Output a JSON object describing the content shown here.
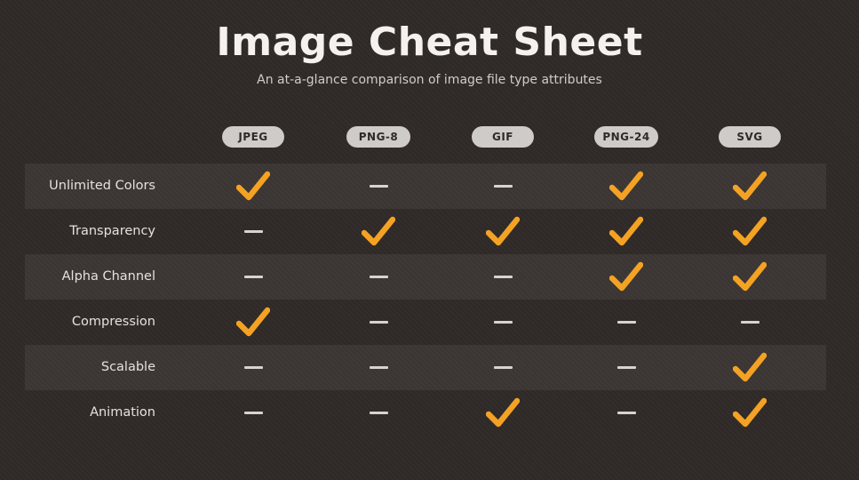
{
  "header": {
    "title": "Image Cheat Sheet",
    "subtitle": "An at-a-glance comparison of image file type attributes"
  },
  "columns": [
    "JPEG",
    "PNG-8",
    "GIF",
    "PNG-24",
    "SVG"
  ],
  "rows": [
    {
      "label": "Unlimited Colors",
      "values": [
        true,
        false,
        false,
        true,
        true
      ]
    },
    {
      "label": "Transparency",
      "values": [
        false,
        true,
        true,
        true,
        true
      ]
    },
    {
      "label": "Alpha Channel",
      "values": [
        false,
        false,
        false,
        true,
        true
      ]
    },
    {
      "label": "Compression",
      "values": [
        true,
        false,
        false,
        false,
        false
      ]
    },
    {
      "label": "Scalable",
      "values": [
        false,
        false,
        false,
        false,
        true
      ]
    },
    {
      "label": "Animation",
      "values": [
        false,
        false,
        true,
        false,
        true
      ]
    }
  ],
  "colors": {
    "check": "#f4a223",
    "background": "#2f2a28",
    "pill": "#cfcbc8",
    "dash": "#d8d3ce"
  },
  "icons": {
    "yes": "checkmark-icon",
    "no": "dash-icon"
  }
}
